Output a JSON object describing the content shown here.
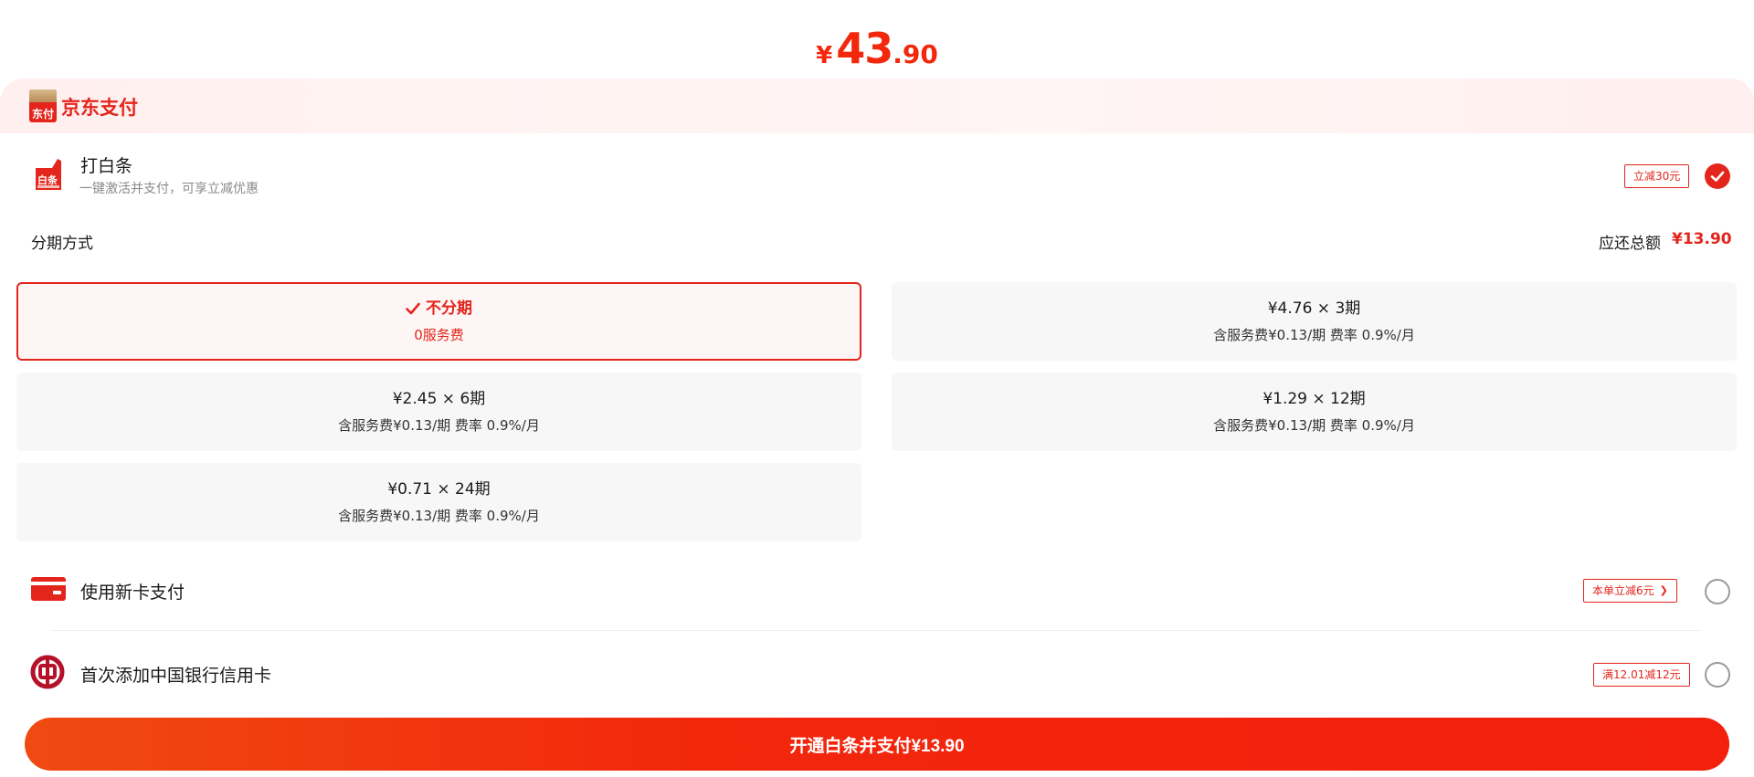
{
  "header": {
    "amount_currency": "¥",
    "amount_integer": "43",
    "amount_decimal": ".90"
  },
  "brand": {
    "logo_text": "东付",
    "name": "京东支付"
  },
  "baitiao": {
    "icon": "baitiao-icon",
    "icon_text": "白条",
    "title": "打白条",
    "subtitle": "一键激活并支付，可享立减优惠",
    "badge": "立减30元",
    "selected": true
  },
  "installment": {
    "label": "分期方式",
    "total_label": "应还总额",
    "total_value": "¥13.90",
    "options": [
      {
        "line1": "不分期",
        "line2": "0服务费",
        "selected": true
      },
      {
        "line1": "¥4.76 × 3期",
        "line2": "含服务费¥0.13/期 费率 0.9%/月",
        "selected": false
      },
      {
        "line1": "¥2.45 × 6期",
        "line2": "含服务费¥0.13/期 费率 0.9%/月",
        "selected": false
      },
      {
        "line1": "¥1.29 × 12期",
        "line2": "含服务费¥0.13/期 费率 0.9%/月",
        "selected": false
      },
      {
        "line1": "¥0.71 × 24期",
        "line2": "含服务费¥0.13/期 费率 0.9%/月",
        "selected": false
      }
    ]
  },
  "new_card": {
    "icon": "credit-card-icon",
    "label": "使用新卡支付",
    "badge": "本单立减6元",
    "badge_arrow": "❯",
    "selected": false
  },
  "boc_card": {
    "icon": "bank-of-china-icon",
    "label": "首次添加中国银行信用卡",
    "badge": "满12.01减12元",
    "selected": false
  },
  "pay_button": {
    "label": "开通白条并支付¥13.90"
  },
  "colors": {
    "accent": "#e3251c",
    "price_red": "#f2270c",
    "option_bg": "#f7f7f7",
    "brand_bar_bg": "#fff0ef"
  }
}
